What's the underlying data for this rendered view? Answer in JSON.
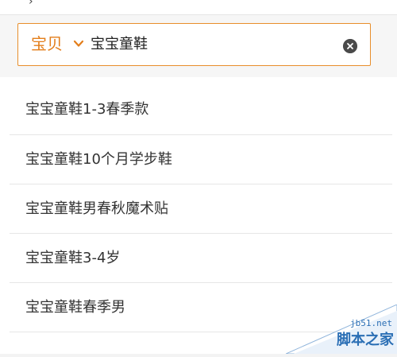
{
  "header": {
    "top_glyph": "›"
  },
  "search": {
    "scope_label": "宝贝",
    "query": "宝宝童鞋"
  },
  "suggestions": [
    "宝宝童鞋1-3春季款",
    "宝宝童鞋10个月学步鞋",
    "宝宝童鞋男春秋魔术贴",
    "宝宝童鞋3-4岁",
    "宝宝童鞋春季男"
  ],
  "watermark": {
    "url": "jb51.net",
    "name": "脚本之家"
  },
  "colors": {
    "accent": "#e37e1b",
    "border": "#e88e2b",
    "watermark": "#2b6fb5"
  },
  "icons": {
    "scope_dropdown": "chevron-down-icon",
    "clear": "clear-icon"
  }
}
